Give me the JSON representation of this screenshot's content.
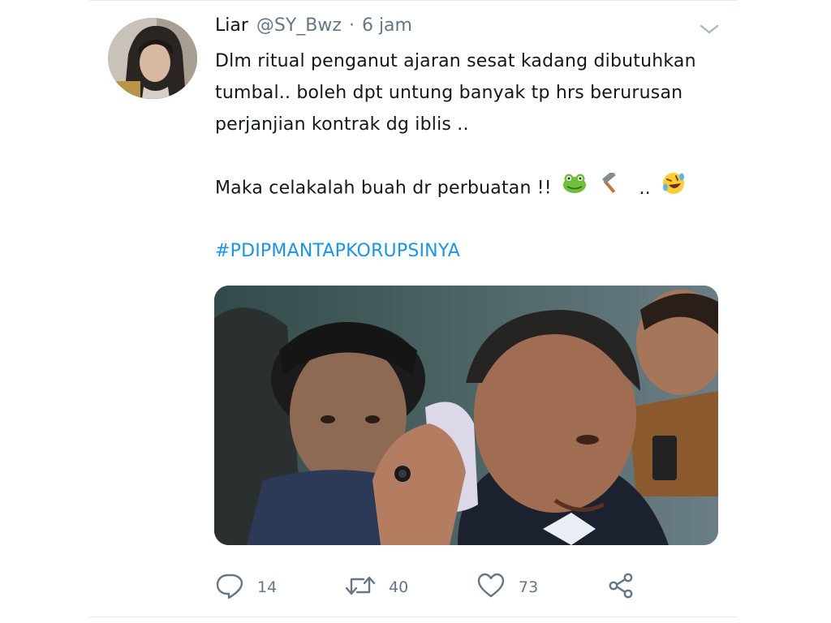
{
  "tweet": {
    "author": {
      "display_name": "Liar",
      "handle": "@SY_Bwz"
    },
    "separator": "·",
    "time": "6 jam",
    "lines": [
      "Dlm ritual penganut ajaran sesat kadang dibutuhkan",
      "tumbal.. boleh dpt untung banyak tp hrs berurusan",
      "perjanjian kontrak dg iblis ..",
      "",
      "Maka celakalah buah dr perbuatan !!"
    ],
    "emoji_separator": "..",
    "emojis": [
      "frog-emoji",
      "hammer-emoji",
      "rolling-laughing-emoji"
    ],
    "hashtag": "#PDIPMANTAPKORUPSINYA",
    "media": {
      "description_icon": "photo"
    },
    "actions": {
      "reply_count": "14",
      "retweet_count": "40",
      "like_count": "73"
    }
  },
  "colors": {
    "text": "#14171a",
    "secondary": "#657786",
    "link": "#1b95e0",
    "border": "#e6ecf0"
  }
}
